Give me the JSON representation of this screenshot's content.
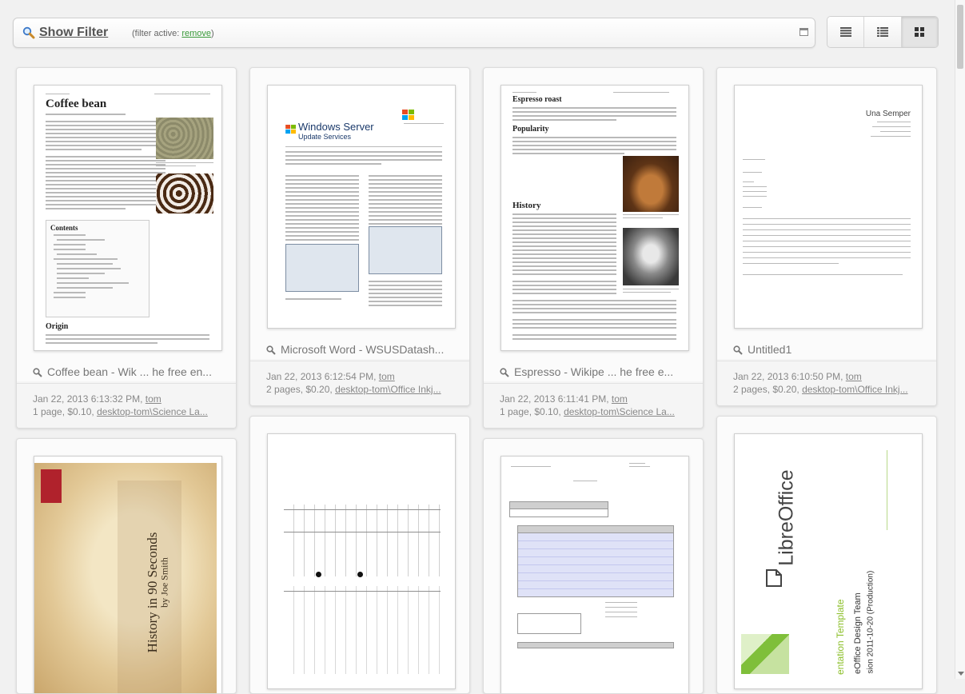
{
  "filter": {
    "show_label": "Show Filter",
    "active_prefix": "(filter active: ",
    "remove_label": "remove",
    "active_suffix": ")"
  },
  "views": [
    "list-view-icon",
    "detail-view-icon",
    "grid-view-icon"
  ],
  "jobs": [
    {
      "title": "Coffee bean - Wik ... he free en...",
      "date": "Jan 22, 2013 6:13:32 PM,",
      "user": "tom",
      "summary": "1 page, $0.10,",
      "printer": "desktop-tom\\Science La...",
      "page_heading": "Coffee bean",
      "contents_heading": "Contents",
      "origin_heading": "Origin"
    },
    {
      "title": "Microsoft Word - WSUSDatash...",
      "date": "Jan 22, 2013 6:12:54 PM,",
      "user": "tom",
      "summary": "2 pages, $0.20,",
      "printer": "desktop-tom\\Office Inkj...",
      "page_heading": "Windows Server",
      "page_subheading": "Update Services"
    },
    {
      "title": "Espresso - Wikipe ... he free e...",
      "date": "Jan 22, 2013 6:11:41 PM,",
      "user": "tom",
      "summary": "1 page, $0.10,",
      "printer": "desktop-tom\\Science La...",
      "page_heading": "Espresso roast",
      "popularity_heading": "Popularity",
      "history_heading": "History"
    },
    {
      "title": "Untitled1",
      "date": "Jan 22, 2013 6:10:50 PM,",
      "user": "tom",
      "summary": "2 pages, $0.20,",
      "printer": "desktop-tom\\Office Inkj...",
      "page_heading": "Una Semper"
    },
    {
      "page_heading": "History in 90 Seconds",
      "page_author": "by Joe Smith"
    },
    {},
    {},
    {
      "page_heading": "LibreOffice",
      "page_side_lines": [
        "entation Template",
        "eOffice Design Team",
        "sion 2011-10-20 (Production)"
      ]
    }
  ]
}
